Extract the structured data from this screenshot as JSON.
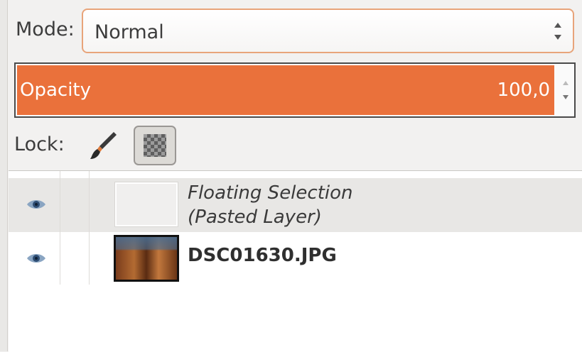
{
  "mode": {
    "label": "Mode:",
    "value": "Normal"
  },
  "opacity": {
    "label": "Opacity",
    "value": "100,0",
    "level_percent": 100
  },
  "lock": {
    "label": "Lock:"
  },
  "layers": [
    {
      "name_line1": "Floating Selection",
      "name_line2": "(Pasted Layer)",
      "visible": true,
      "selected": true
    },
    {
      "name": "DSC01630.JPG",
      "visible": true,
      "selected": false
    }
  ],
  "colors": {
    "accent": "#ea713b",
    "focus_border": "#e8a47a"
  }
}
